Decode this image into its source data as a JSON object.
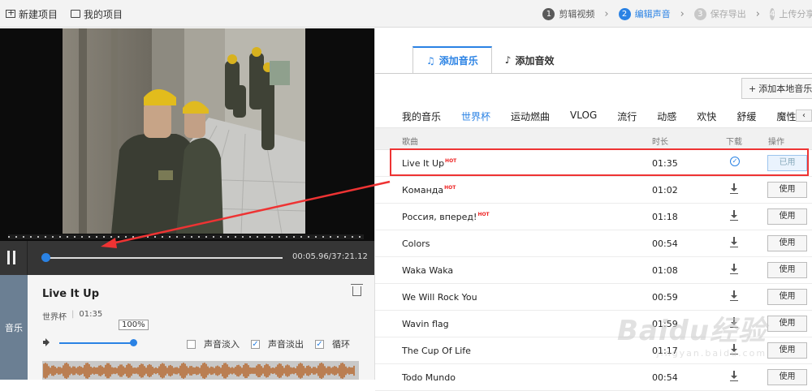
{
  "topbar": {
    "new_project": "新建项目",
    "my_projects": "我的项目",
    "steps": [
      {
        "num": "1",
        "label": "剪辑视频"
      },
      {
        "num": "2",
        "label": "编辑声音"
      },
      {
        "num": "3",
        "label": "保存导出"
      },
      {
        "num": "4",
        "label": "上传分享"
      }
    ]
  },
  "player": {
    "time": "00:05.96/37:21.12"
  },
  "music_panel": {
    "side_label": "音乐",
    "title": "Live It Up",
    "category": "世界杯",
    "duration": "01:35",
    "volume_label": "100%",
    "volume_fraction": 1.0,
    "options": [
      {
        "label": "声音淡入",
        "checked": false
      },
      {
        "label": "声音淡出",
        "checked": true
      },
      {
        "label": "循环",
        "checked": true
      }
    ]
  },
  "library": {
    "tabs": [
      {
        "label": "添加音乐",
        "icon": "music-note-icon",
        "active": true
      },
      {
        "label": "添加音效",
        "icon": "sound-effect-icon",
        "active": false
      }
    ],
    "add_local": "添加本地音乐",
    "categories": [
      "我的音乐",
      "世界杯",
      "运动燃曲",
      "VLOG",
      "流行",
      "动感",
      "欢快",
      "舒缓",
      "魔性"
    ],
    "active_category": "世界杯",
    "columns": {
      "song": "歌曲",
      "duration": "时长",
      "download": "下载",
      "action": "操作"
    },
    "hot_badge": "HOT",
    "rows": [
      {
        "name": "Live It Up",
        "hot": true,
        "duration": "01:35",
        "downloaded": true,
        "action": "已用"
      },
      {
        "name": "Команда",
        "hot": true,
        "duration": "01:02",
        "downloaded": false,
        "action": "使用"
      },
      {
        "name": "Россия, вперед!",
        "hot": true,
        "duration": "01:18",
        "downloaded": false,
        "action": "使用"
      },
      {
        "name": "Colors",
        "hot": false,
        "duration": "00:54",
        "downloaded": false,
        "action": "使用"
      },
      {
        "name": "Waka Waka",
        "hot": false,
        "duration": "01:08",
        "downloaded": false,
        "action": "使用"
      },
      {
        "name": "We Will Rock You",
        "hot": false,
        "duration": "00:59",
        "downloaded": false,
        "action": "使用"
      },
      {
        "name": "Wavin flag",
        "hot": false,
        "duration": "01:59",
        "downloaded": false,
        "action": "使用"
      },
      {
        "name": "The Cup Of Life",
        "hot": false,
        "duration": "01:17",
        "downloaded": false,
        "action": "使用"
      },
      {
        "name": "Todo Mundo",
        "hot": false,
        "duration": "00:54",
        "downloaded": false,
        "action": "使用"
      }
    ]
  },
  "watermark": {
    "brand": "Baidu经验",
    "url": "jingyan.baidu.com"
  },
  "colors": {
    "accent": "#2a82e4",
    "highlight": "#e33333",
    "waveform": "#b5652a"
  }
}
